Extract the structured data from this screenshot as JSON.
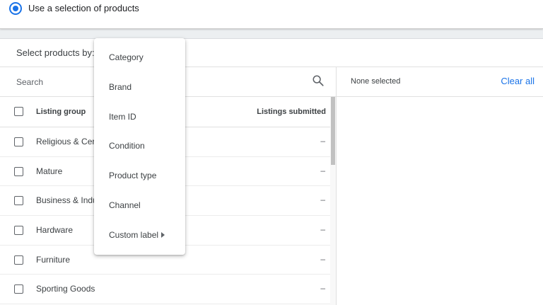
{
  "selection_mode": {
    "radio_label": "Use a selection of products",
    "selected": true
  },
  "selector": {
    "label": "Select products by:",
    "menu_items": [
      {
        "label": "Category"
      },
      {
        "label": "Brand"
      },
      {
        "label": "Item ID"
      },
      {
        "label": "Condition"
      },
      {
        "label": "Product type"
      },
      {
        "label": "Channel"
      },
      {
        "label": "Custom label",
        "has_submenu": true
      }
    ]
  },
  "left_pane": {
    "search": {
      "placeholder": "Search",
      "value": "",
      "icon": "search-icon"
    },
    "columns": {
      "listing_group": "Listing group",
      "listings_submitted": "Listings submitted"
    },
    "rows": [
      {
        "label": "Religious & Cere",
        "value": "–"
      },
      {
        "label": "Mature",
        "value": "–"
      },
      {
        "label": "Business & Indus",
        "value": "–"
      },
      {
        "label": "Hardware",
        "value": "–"
      },
      {
        "label": "Furniture",
        "value": "–"
      },
      {
        "label": "Sporting Goods",
        "value": "–"
      }
    ]
  },
  "right_pane": {
    "status": "None selected",
    "clear_label": "Clear all"
  },
  "colors": {
    "accent": "#1a73e8",
    "text": "#3c4043",
    "background": "#eceff1"
  }
}
